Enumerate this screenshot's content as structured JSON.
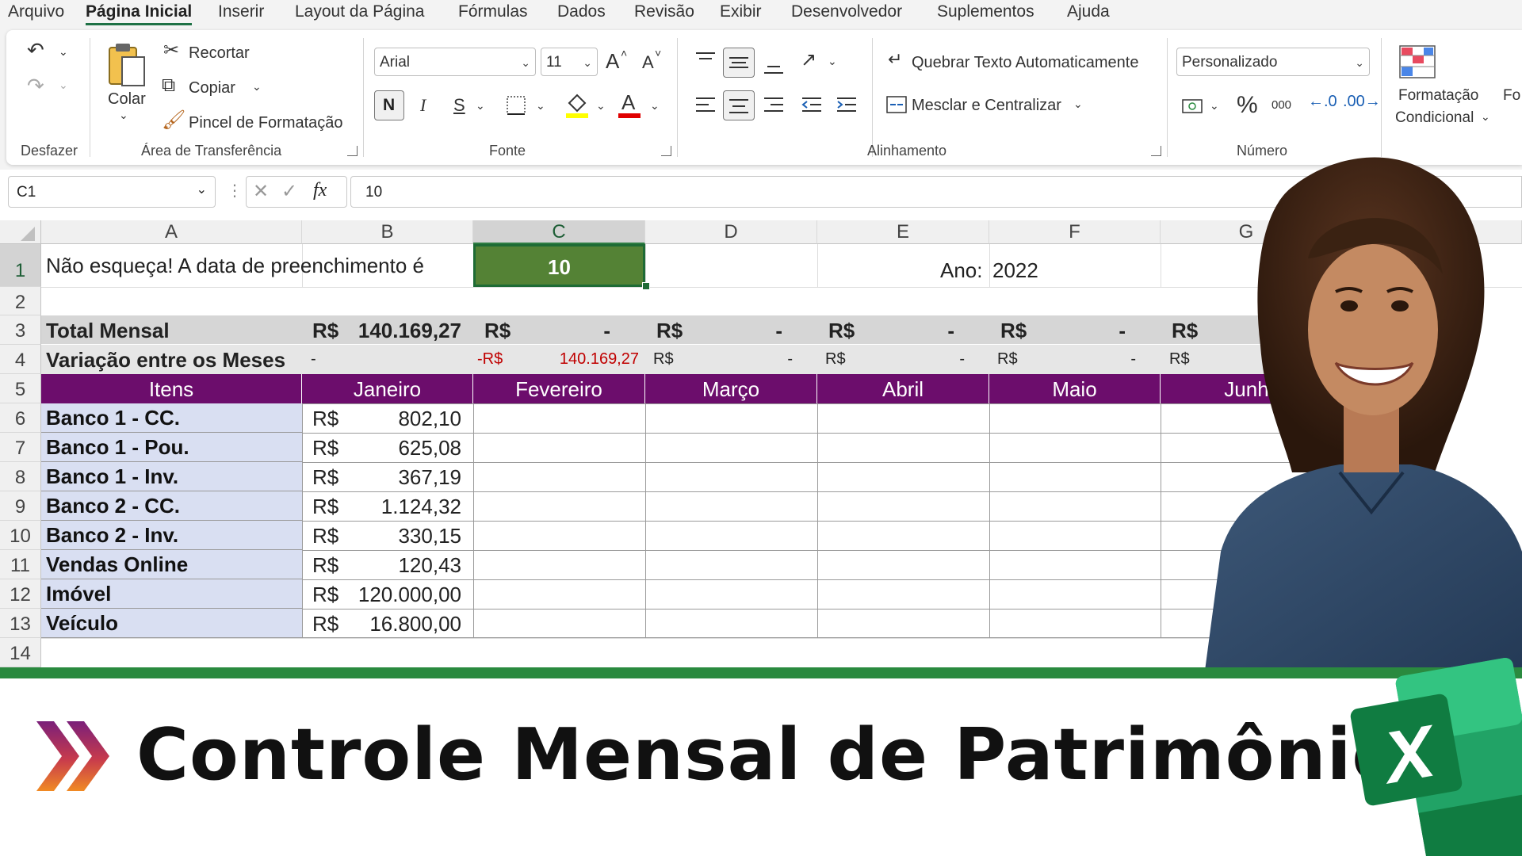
{
  "menu": [
    "Arquivo",
    "Página Inicial",
    "Inserir",
    "Layout da Página",
    "Fórmulas",
    "Dados",
    "Revisão",
    "Exibir",
    "Desenvolvedor",
    "Suplementos",
    "Ajuda"
  ],
  "ribbon": {
    "undo_group": "Desfazer",
    "clipboard": {
      "paste": "Colar",
      "cut": "Recortar",
      "copy": "Copiar",
      "format_painter": "Pincel de Formatação",
      "label": "Área de Transferência"
    },
    "font": {
      "name": "Arial",
      "size": "11",
      "bold": "N",
      "italic": "I",
      "underline": "S",
      "color_letter": "A",
      "grow": "A",
      "shrink": "A",
      "label": "Fonte"
    },
    "alignment": {
      "wrap": "Quebrar Texto Automaticamente",
      "merge": "Mesclar e Centralizar",
      "label": "Alinhamento"
    },
    "number": {
      "format": "Personalizado",
      "percent": "%",
      "thousands": "000",
      "label": "Número"
    },
    "styles": {
      "conditional_line1": "Formatação",
      "conditional_line2": "Condicional",
      "next_cut": "Fo"
    }
  },
  "formula_bar": {
    "cell_ref": "C1",
    "fx": "fx",
    "content": "10"
  },
  "columns": [
    "A",
    "B",
    "C",
    "D",
    "E",
    "F",
    "G"
  ],
  "rows": [
    "1",
    "2",
    "3",
    "4",
    "5",
    "6",
    "7",
    "8",
    "9",
    "10",
    "11",
    "12",
    "13",
    "14"
  ],
  "sheet": {
    "reminder": "Não esqueça! A data de preenchimento é",
    "day_value": "10",
    "year_label": "Ano:",
    "year_value": "2022",
    "total_label": "Total Mensal",
    "variation_label": "Variação entre os Meses",
    "currency": "R$",
    "total_jan": "140.169,27",
    "dash": "-",
    "variation_feb_currency": "-R$",
    "variation_feb": "140.169,27",
    "header_items": "Itens",
    "months": [
      "Janeiro",
      "Fevereiro",
      "Março",
      "Abril",
      "Maio",
      "Junh"
    ],
    "items": [
      {
        "name": "Banco 1 - CC.",
        "jan": "802,10"
      },
      {
        "name": "Banco 1 - Pou.",
        "jan": "625,08"
      },
      {
        "name": "Banco 1 - Inv.",
        "jan": "367,19"
      },
      {
        "name": "Banco 2 - CC.",
        "jan": "1.124,32"
      },
      {
        "name": "Banco 2 - Inv.",
        "jan": "330,15"
      },
      {
        "name": "Vendas Online",
        "jan": "120,43"
      },
      {
        "name": "Imóvel",
        "jan": "120.000,00"
      },
      {
        "name": "Veículo",
        "jan": "16.800,00"
      }
    ]
  },
  "banner": {
    "title": "Controle Mensal de Patrimônio",
    "logo_letter": "X"
  },
  "colors": {
    "excel_green": "#1e7145",
    "banner_green": "#2a8a3f",
    "header_purple": "#6c0d6c",
    "cell_green": "#548235",
    "items_blue": "#d9dff2",
    "negative_red": "#c00000"
  }
}
